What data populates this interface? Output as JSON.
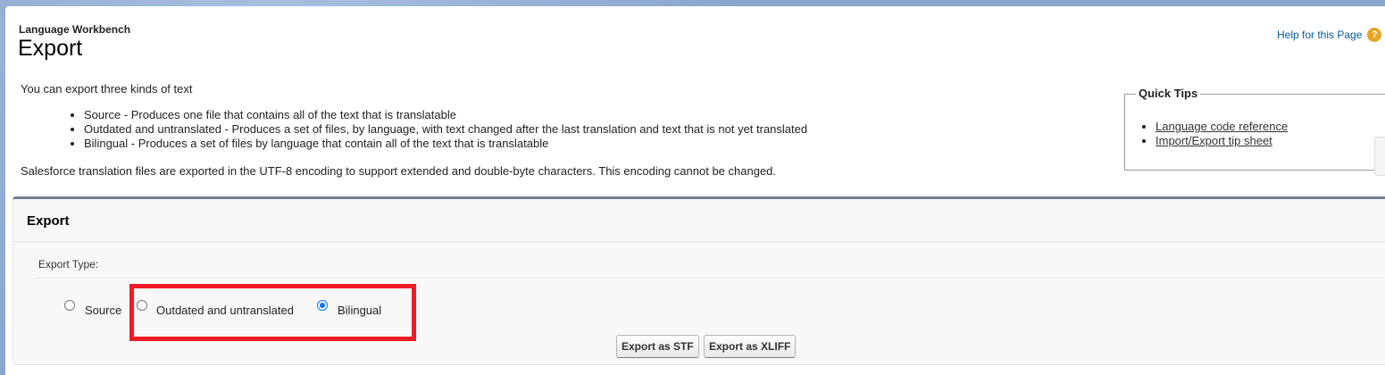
{
  "header": {
    "breadcrumb": "Language Workbench",
    "title": "Export",
    "help_link": "Help for this Page",
    "help_icon": "?"
  },
  "intro": {
    "text": "You can export three kinds of text",
    "bullets": [
      "Source - Produces one file that contains all of the text that is translatable",
      "Outdated and untranslated - Produces a set of files, by language, with text changed after the last translation and text that is not yet translated",
      "Bilingual - Produces a set of files by language that contain all of the text that is translatable"
    ],
    "encoding_note": "Salesforce translation files are exported in the UTF-8 encoding to support extended and double-byte characters. This encoding cannot be changed."
  },
  "quick_tips": {
    "title": "Quick Tips",
    "links": [
      "Language code reference",
      "Import/Export tip sheet"
    ]
  },
  "export_panel": {
    "title": "Export",
    "field_label": "Export Type:",
    "options": [
      {
        "label": "Source",
        "checked": false
      },
      {
        "label": "Outdated and untranslated",
        "checked": false
      },
      {
        "label": "Bilingual",
        "checked": true
      }
    ],
    "buttons": {
      "stf": "Export as STF",
      "xliff": "Export as XLIFF"
    }
  },
  "colors": {
    "accent_link": "#015ba7",
    "highlight_box": "#ee1c24",
    "radio_selected": "#0075ff"
  }
}
